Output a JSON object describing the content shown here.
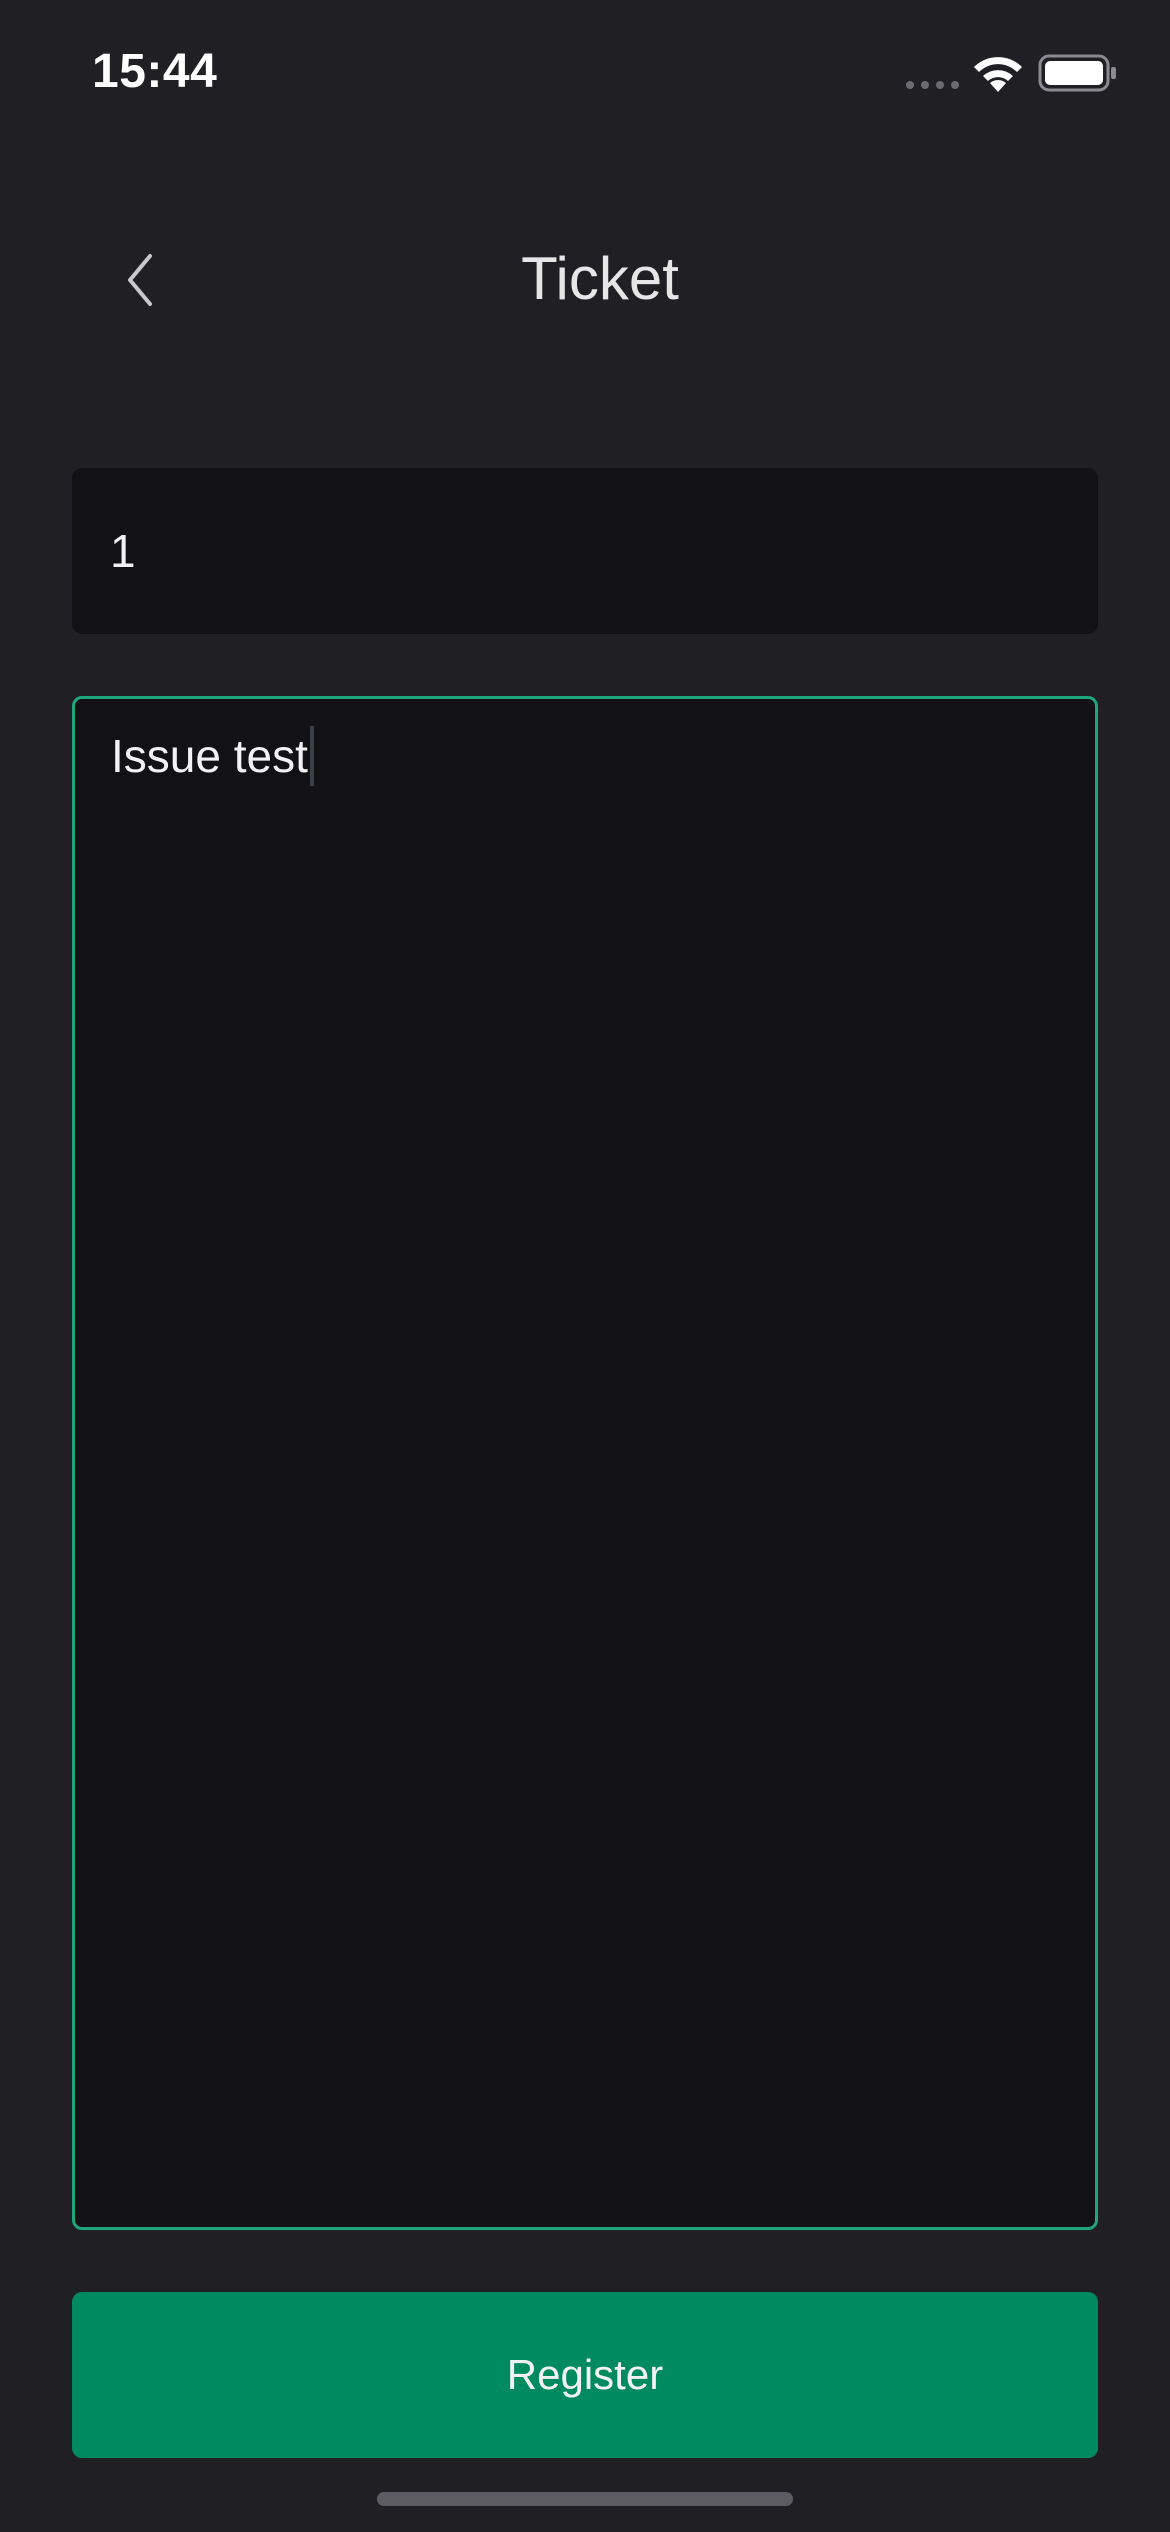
{
  "status_bar": {
    "time": "15:44"
  },
  "header": {
    "title": "Ticket",
    "back_icon": "chevron-left-icon"
  },
  "form": {
    "ticket_number_value": "1",
    "issue_value": "Issue test"
  },
  "actions": {
    "register_label": "Register"
  },
  "colors": {
    "background": "#202024",
    "field_background": "#121214",
    "focus_border": "#1fa57a",
    "primary_button": "#008a5f"
  }
}
